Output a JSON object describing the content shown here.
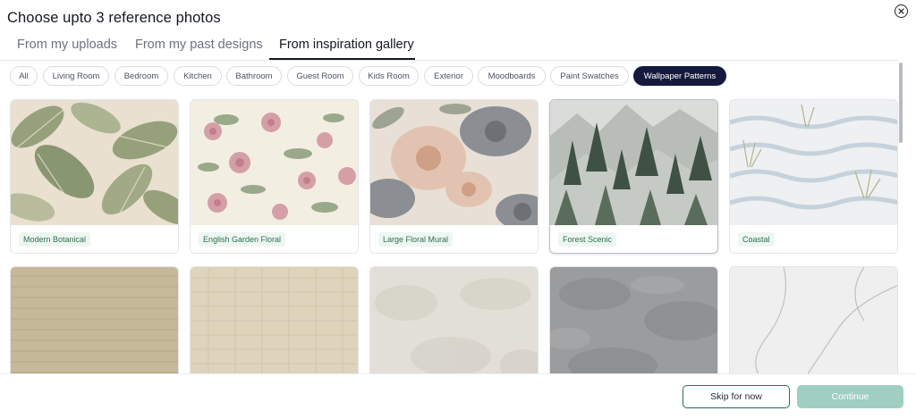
{
  "modal": {
    "title": "Choose upto 3 reference photos",
    "close_icon": "close-icon"
  },
  "tabs": [
    {
      "label": "From my uploads",
      "active": false
    },
    {
      "label": "From my past designs",
      "active": false
    },
    {
      "label": "From inspiration gallery",
      "active": true
    }
  ],
  "filters": [
    {
      "label": "All",
      "active": false
    },
    {
      "label": "Living Room",
      "active": false
    },
    {
      "label": "Bedroom",
      "active": false
    },
    {
      "label": "Kitchen",
      "active": false
    },
    {
      "label": "Bathroom",
      "active": false
    },
    {
      "label": "Guest Room",
      "active": false
    },
    {
      "label": "Kids Room",
      "active": false
    },
    {
      "label": "Exterior",
      "active": false
    },
    {
      "label": "Moodboards",
      "active": false
    },
    {
      "label": "Paint Swatches",
      "active": false
    },
    {
      "label": "Wallpaper Patterns",
      "active": true
    }
  ],
  "gallery": {
    "row1": [
      {
        "label": "Modern Botanical",
        "pattern": "tropical-leaves"
      },
      {
        "label": "English Garden Floral",
        "pattern": "rose-floral"
      },
      {
        "label": "Large Floral Mural",
        "pattern": "peony-mural"
      },
      {
        "label": "Forest Scenic",
        "pattern": "pine-forest",
        "selected": true
      },
      {
        "label": "Coastal",
        "pattern": "coastal-waves"
      }
    ],
    "row2": [
      {
        "pattern": "grasscloth-tan"
      },
      {
        "pattern": "linen-beige"
      },
      {
        "pattern": "plaster-cream"
      },
      {
        "pattern": "concrete-grey"
      },
      {
        "pattern": "marble-white"
      }
    ]
  },
  "footer": {
    "skip_label": "Skip for now",
    "continue_label": "Continue"
  },
  "colors": {
    "accent_dark": "#151a3d",
    "label_bg": "#eef6f1",
    "label_text": "#2e6f4f",
    "continue_bg": "#9fcfc1",
    "skip_border": "#2f6f66"
  }
}
